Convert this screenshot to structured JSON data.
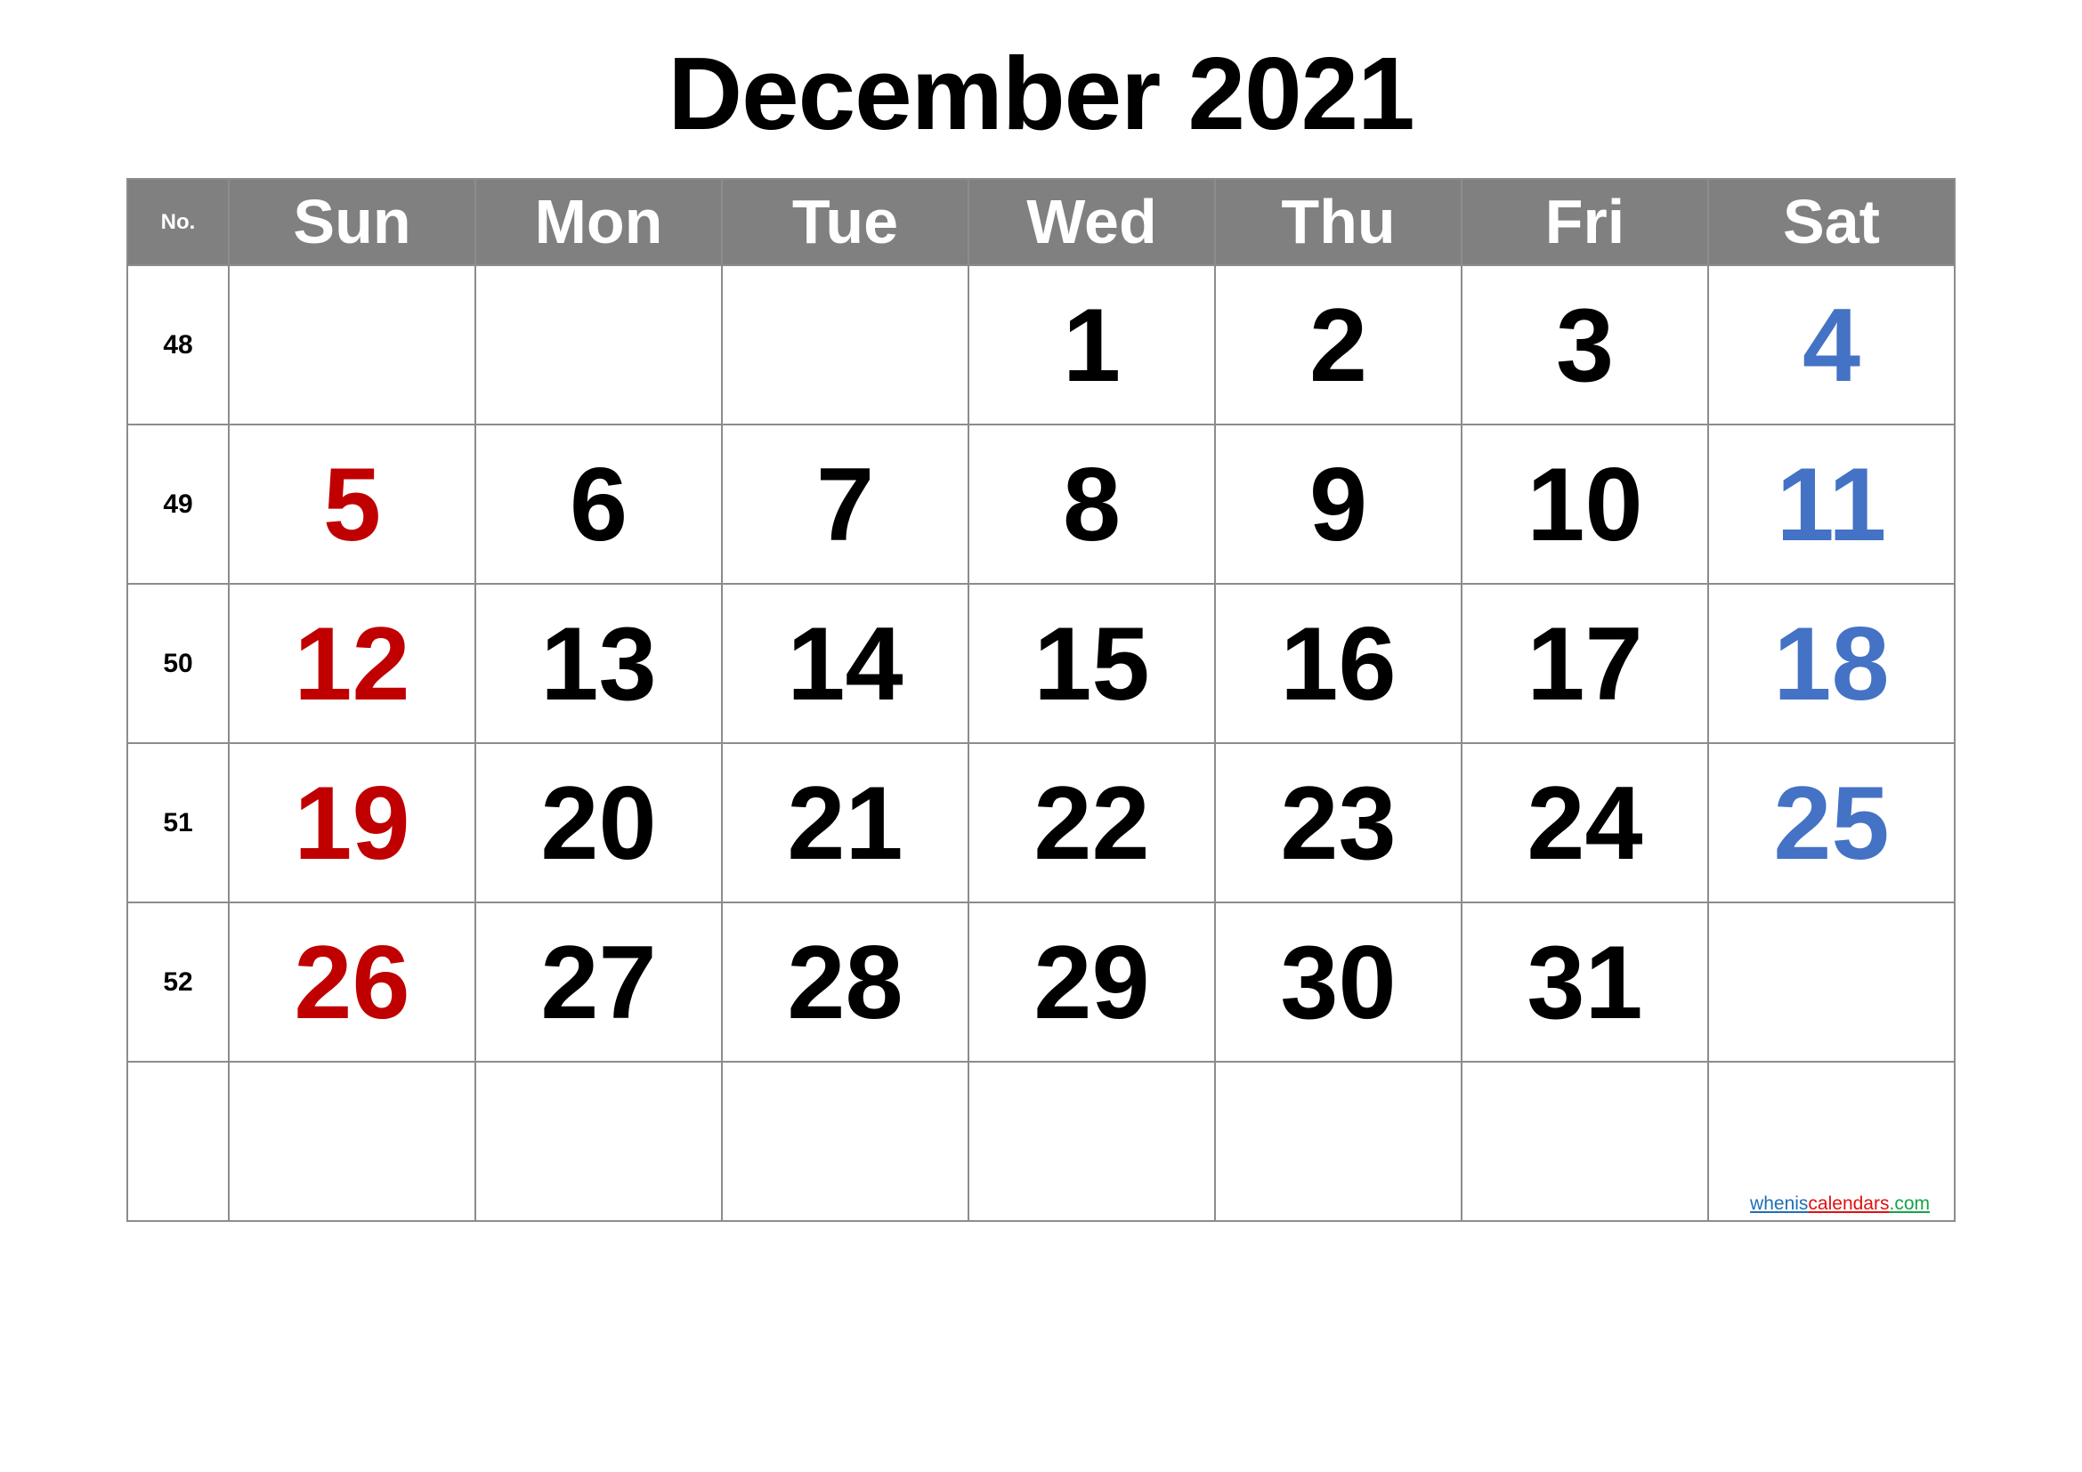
{
  "title": "December 2021",
  "header": {
    "week_label": "No.",
    "days": [
      "Sun",
      "Mon",
      "Tue",
      "Wed",
      "Thu",
      "Fri",
      "Sat"
    ]
  },
  "colors": {
    "header_bg": "#808080",
    "sunday": "#C00000",
    "saturday": "#4472C4",
    "weekday": "#000000",
    "grid": "#8c8c8c"
  },
  "weeks": [
    {
      "no": "48",
      "days": [
        "",
        "",
        "",
        "1",
        "2",
        "3",
        "4"
      ]
    },
    {
      "no": "49",
      "days": [
        "5",
        "6",
        "7",
        "8",
        "9",
        "10",
        "11"
      ]
    },
    {
      "no": "50",
      "days": [
        "12",
        "13",
        "14",
        "15",
        "16",
        "17",
        "18"
      ]
    },
    {
      "no": "51",
      "days": [
        "19",
        "20",
        "21",
        "22",
        "23",
        "24",
        "25"
      ]
    },
    {
      "no": "52",
      "days": [
        "26",
        "27",
        "28",
        "29",
        "30",
        "31",
        ""
      ]
    },
    {
      "no": "",
      "days": [
        "",
        "",
        "",
        "",
        "",
        "",
        ""
      ]
    }
  ],
  "footer_link": {
    "part1": "whenis",
    "part2": "calendars",
    "part3": ".com"
  }
}
